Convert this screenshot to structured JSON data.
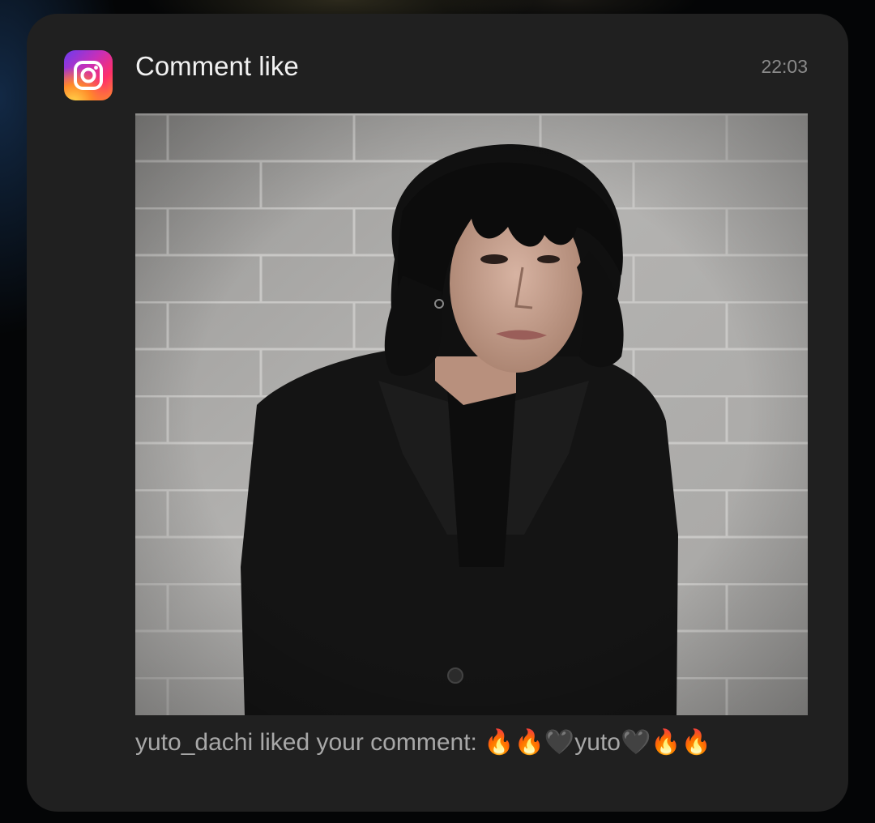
{
  "notification": {
    "app_icon": "instagram-icon",
    "title": "Comment like",
    "time": "22:03",
    "message": "yuto_dachi liked your comment: 🔥🔥🖤yuto🖤🔥🔥",
    "image": "photo-thumbnail"
  },
  "colors": {
    "card_background": "#202020",
    "title_text": "#f1f1f1",
    "secondary_text": "#a8a8a8",
    "time_text": "#8a8a8a"
  }
}
